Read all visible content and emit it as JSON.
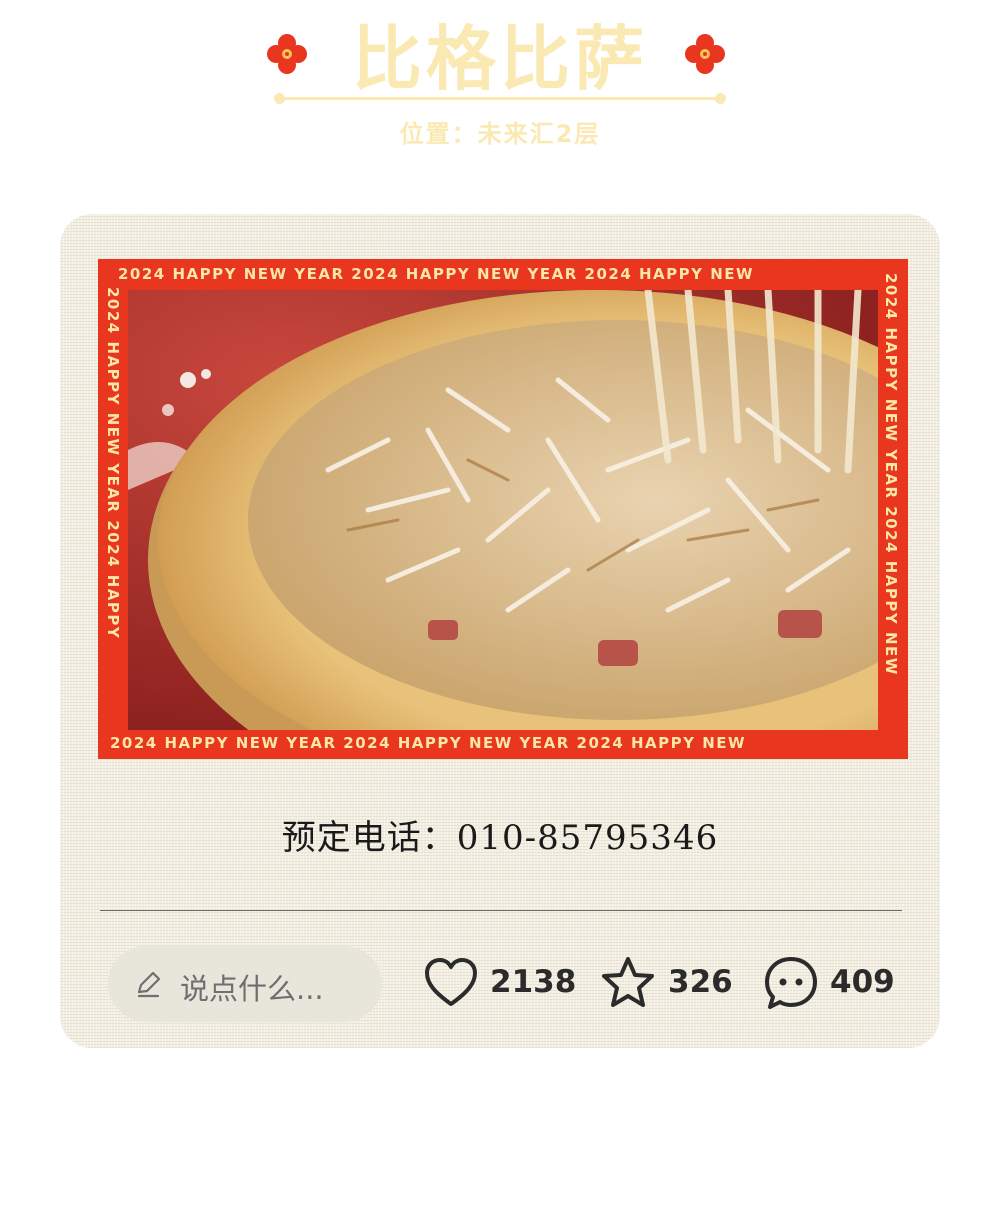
{
  "header": {
    "title": "比格比萨",
    "subtitle": "位置：未来汇2层",
    "ornament_color": "#e8361f"
  },
  "photo": {
    "frame_color": "#e8361f",
    "frame_text_top": "2024  HAPPY NEW YEAR   2024  HAPPY NEW YEAR   2024  HAPPY NEW",
    "frame_text_bottom": "2024  HAPPY NEW YEAR   2024  HAPPY NEW YEAR   2024  HAPPY NEW",
    "frame_text_left": "2024 HAPPY NEW YEAR 2024 HAPPY",
    "frame_text_right": "2024 HAPPY NEW YEAR 2024 HAPPY NEW",
    "subject": "pizza-photo"
  },
  "info": {
    "phone": "预定电话：010-85795346"
  },
  "actions": {
    "comment_placeholder": "说点什么...",
    "likes": "2138",
    "favorites": "326",
    "comments": "409"
  }
}
